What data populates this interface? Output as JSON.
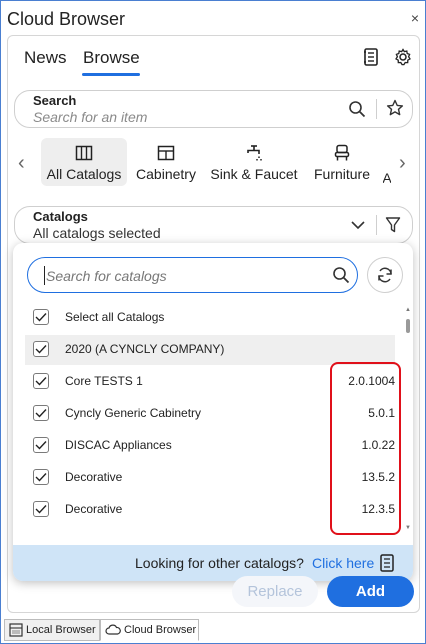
{
  "window": {
    "title": "Cloud Browser",
    "close_glyph": "×"
  },
  "tabs": [
    {
      "label": "News",
      "active": false
    },
    {
      "label": "Browse",
      "active": true
    }
  ],
  "header_icons": [
    "catalog-list-icon",
    "gear-icon"
  ],
  "search": {
    "label": "Search",
    "placeholder": "Search for an item"
  },
  "categories": [
    {
      "label": "All Catalogs",
      "icon": "columns-icon",
      "active": true
    },
    {
      "label": "Cabinetry",
      "icon": "cabinet-icon",
      "active": false
    },
    {
      "label": "Sink & Faucet",
      "icon": "faucet-icon",
      "active": false
    },
    {
      "label": "Furniture",
      "icon": "chair-icon",
      "active": false
    },
    {
      "label": "A",
      "icon": "",
      "active": false
    }
  ],
  "catalogs": {
    "label": "Catalogs",
    "value": "All catalogs selected"
  },
  "dropdown": {
    "search_placeholder": "Search for catalogs",
    "items": [
      {
        "label": "Select all Catalogs",
        "version": "",
        "checked": true
      },
      {
        "label": "2020 (A CYNCLY COMPANY)",
        "version": "",
        "checked": true
      },
      {
        "label": "Core TESTS 1",
        "version": "2.0.1004",
        "checked": true
      },
      {
        "label": "Cyncly Generic Cabinetry",
        "version": "5.0.1",
        "checked": true
      },
      {
        "label": "DISCAC Appliances",
        "version": "1.0.22",
        "checked": true
      },
      {
        "label": "Decorative",
        "version": "13.5.2",
        "checked": true
      },
      {
        "label": "Decorative",
        "version": "12.3.5",
        "checked": true
      }
    ],
    "footer_text": "Looking for other catalogs?",
    "footer_link": "Click here"
  },
  "actions": {
    "replace": "Replace",
    "add": "Add"
  },
  "bottom_tabs": [
    {
      "label": "Local Browser",
      "active": false
    },
    {
      "label": "Cloud Browser",
      "active": true
    }
  ],
  "colors": {
    "accent": "#1f6fe0",
    "highlight": "#e0101a",
    "footer_bg": "#cfe4f7"
  }
}
